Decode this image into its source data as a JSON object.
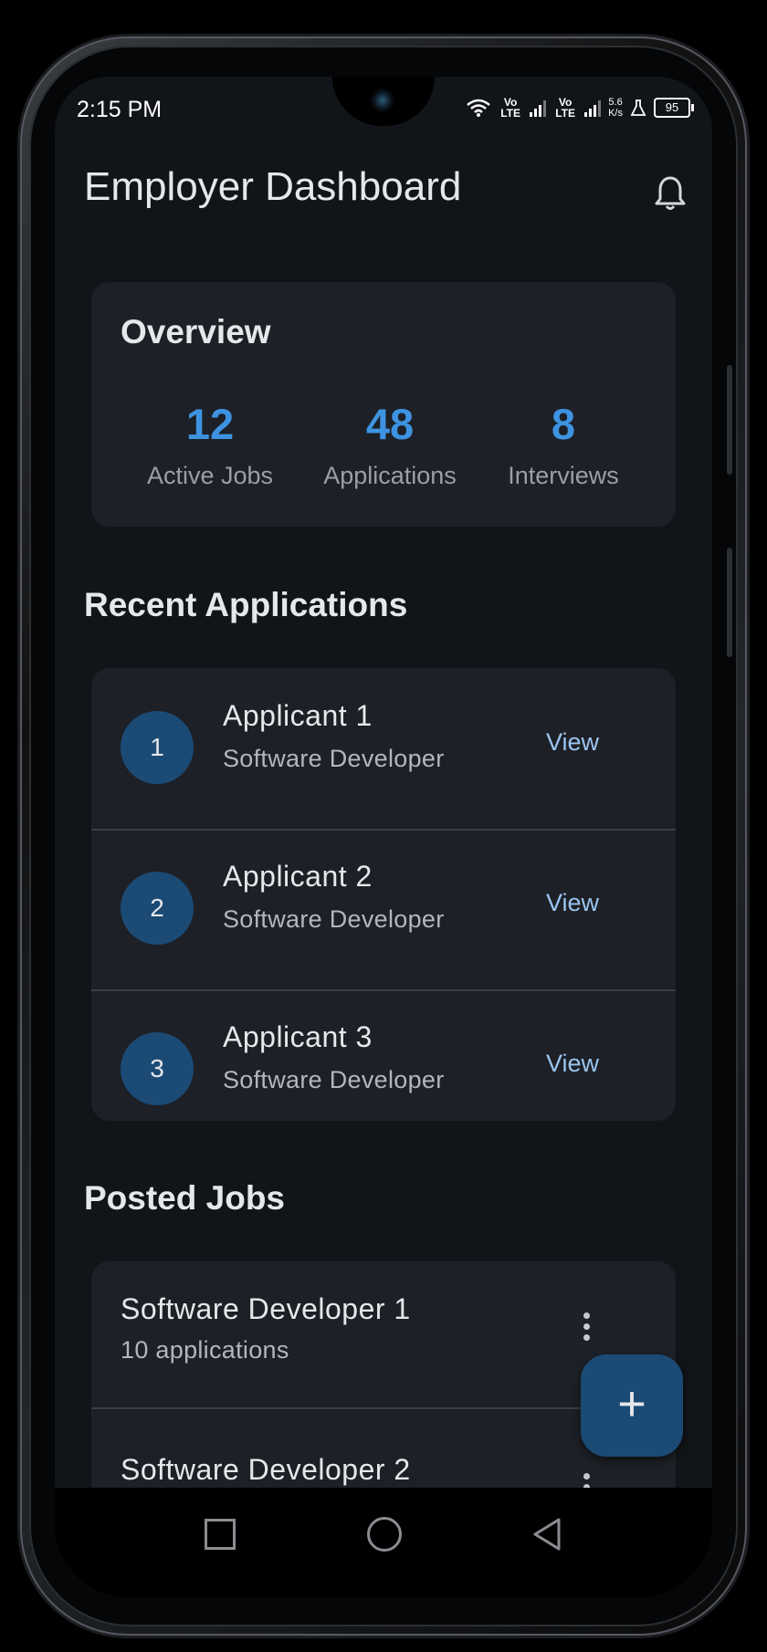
{
  "status": {
    "time": "2:15 PM",
    "lte1": "Vo LTE",
    "lte2": "Vo LTE",
    "speed_value": "5.6",
    "speed_unit": "K/s",
    "battery": "95"
  },
  "header": {
    "title": "Employer Dashboard",
    "notifications_icon": "bell-icon"
  },
  "overview": {
    "title": "Overview",
    "stats": [
      {
        "value": "12",
        "label": "Active Jobs"
      },
      {
        "value": "48",
        "label": "Applications"
      },
      {
        "value": "8",
        "label": "Interviews"
      }
    ],
    "accent_color": "#3d93e1"
  },
  "recent_applications": {
    "title": "Recent Applications",
    "items": [
      {
        "avatar": "1",
        "name": "Applicant 1",
        "role": "Software Developer",
        "action": "View"
      },
      {
        "avatar": "2",
        "name": "Applicant 2",
        "role": "Software Developer",
        "action": "View"
      },
      {
        "avatar": "3",
        "name": "Applicant 3",
        "role": "Software Developer",
        "action": "View"
      }
    ]
  },
  "posted_jobs": {
    "title": "Posted Jobs",
    "items": [
      {
        "title": "Software Developer 1",
        "subtitle": "10 applications",
        "menu_icon": "more-vert-icon"
      },
      {
        "title": "Software Developer 2",
        "subtitle": "",
        "menu_icon": "more-vert-icon"
      }
    ]
  },
  "fab": {
    "label": "+",
    "icon": "add-icon"
  },
  "nav": {
    "recents_icon": "square-icon",
    "home_icon": "circle-icon",
    "back_icon": "triangle-back-icon"
  }
}
